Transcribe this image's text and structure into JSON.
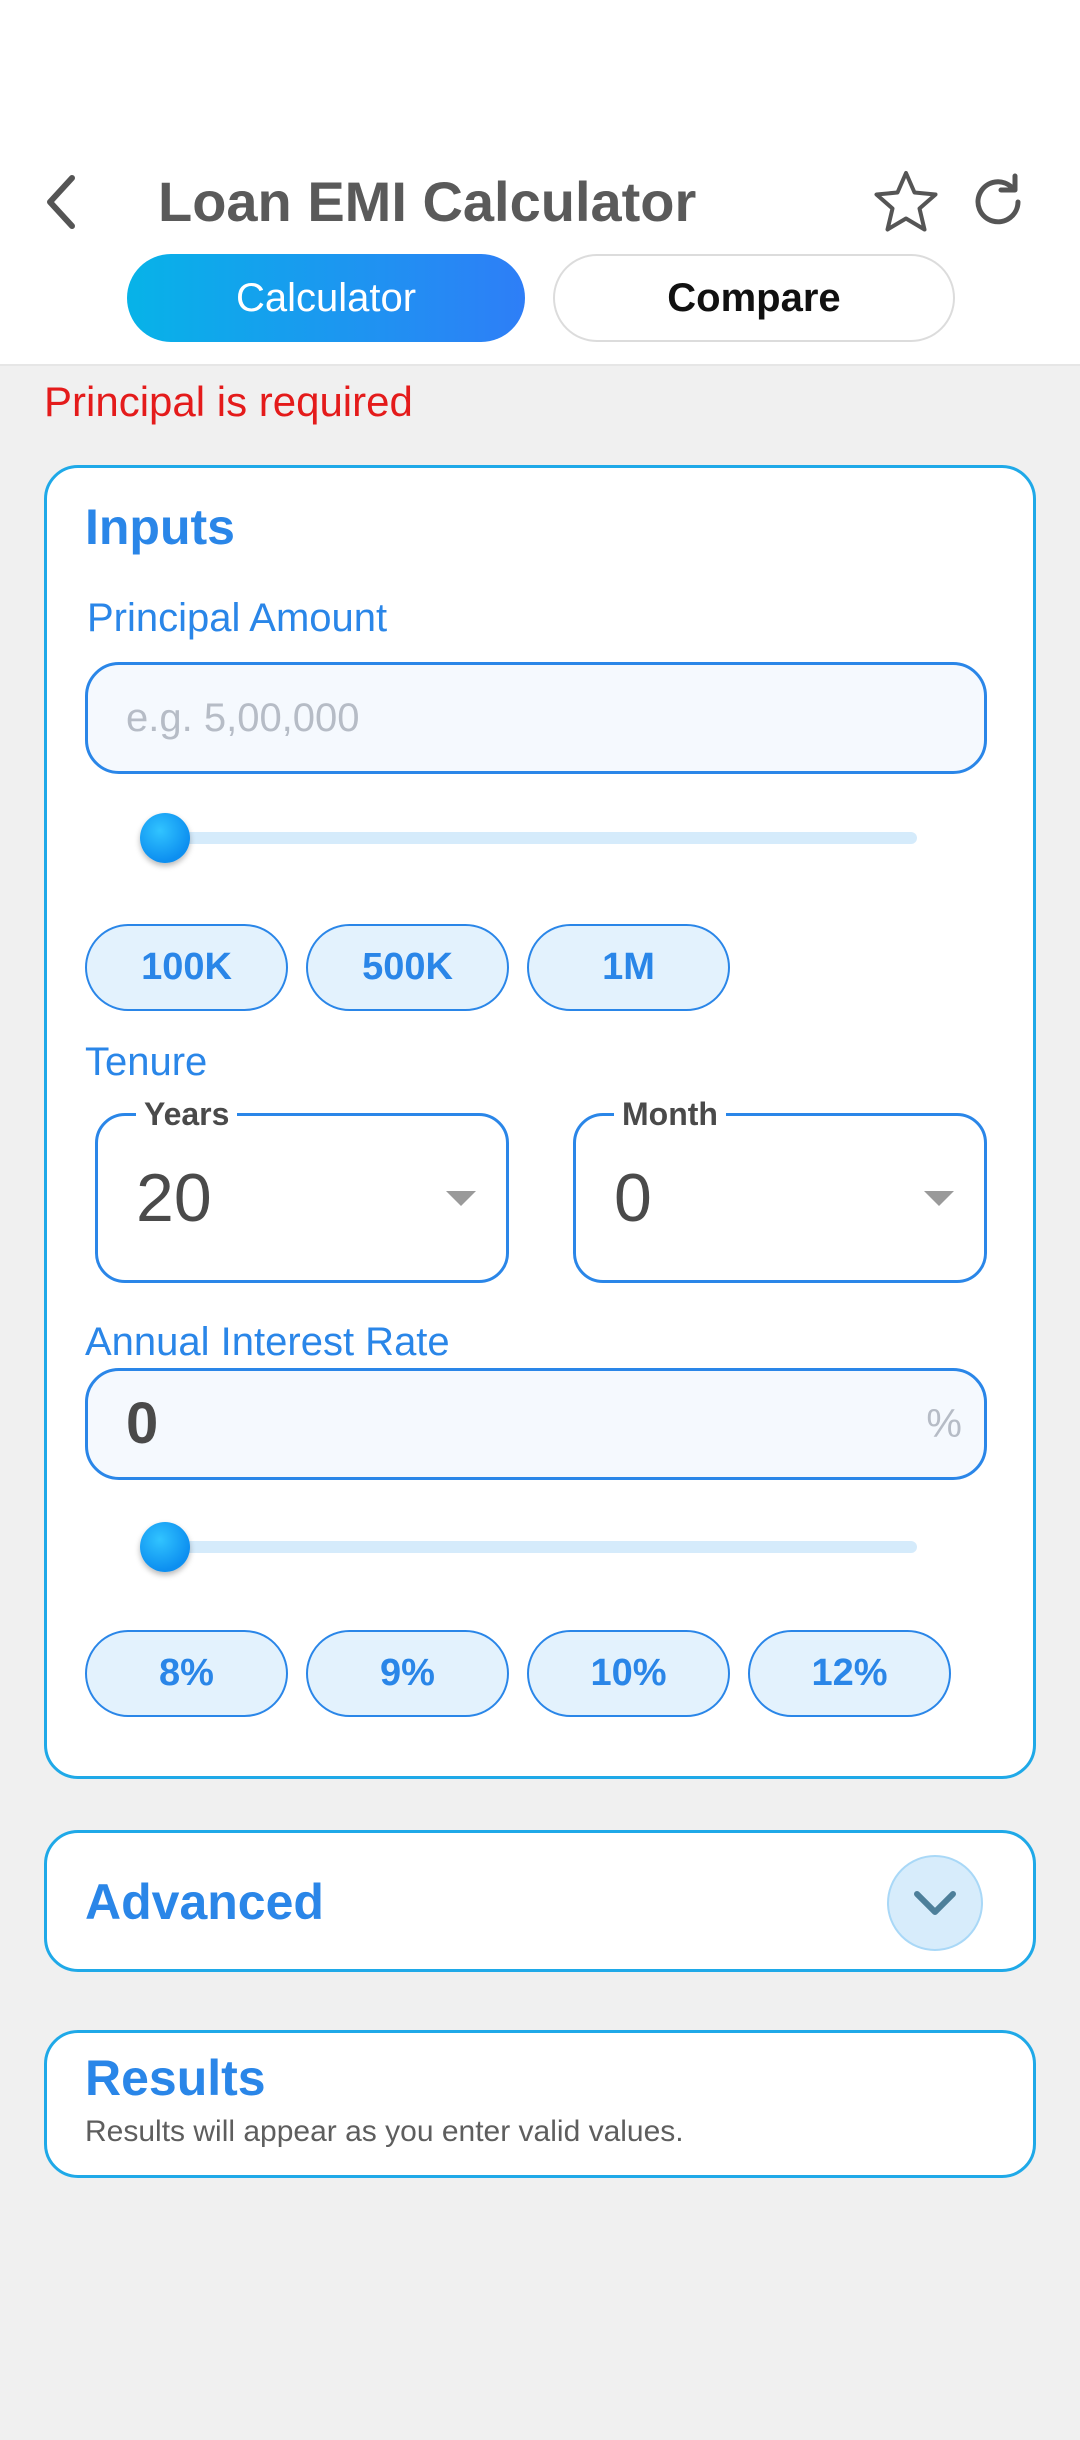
{
  "header": {
    "title": "Loan EMI Calculator",
    "back_icon": "back-chevron-icon",
    "favorite_icon": "star-icon",
    "refresh_icon": "refresh-icon"
  },
  "tabs": [
    {
      "label": "Calculator",
      "selected": true
    },
    {
      "label": "Compare",
      "selected": false
    }
  ],
  "error_message": "Principal is required",
  "inputs": {
    "section_title": "Inputs",
    "principal": {
      "label": "Principal Amount",
      "value": "",
      "placeholder": "e.g. 5,00,000",
      "slider_fraction": 0,
      "presets": [
        "100K",
        "500K",
        "1M"
      ]
    },
    "tenure": {
      "label": "Tenure",
      "years": {
        "label": "Years",
        "value": "20"
      },
      "month": {
        "label": "Month",
        "value": "0"
      }
    },
    "interest": {
      "label": "Annual Interest Rate",
      "value": "0",
      "suffix": "%",
      "slider_fraction": 0,
      "presets": [
        "8%",
        "9%",
        "10%",
        "12%"
      ]
    }
  },
  "advanced": {
    "title": "Advanced",
    "expand_icon": "chevron-down-icon"
  },
  "results": {
    "title": "Results",
    "message": "Results will appear as you enter valid values."
  },
  "colors": {
    "accent": "#2a86e8",
    "tab_gradient_start": "#07b3e8",
    "tab_gradient_end": "#2e7ef7",
    "error": "#e41b1b",
    "card_border": "#1fa9e8"
  }
}
